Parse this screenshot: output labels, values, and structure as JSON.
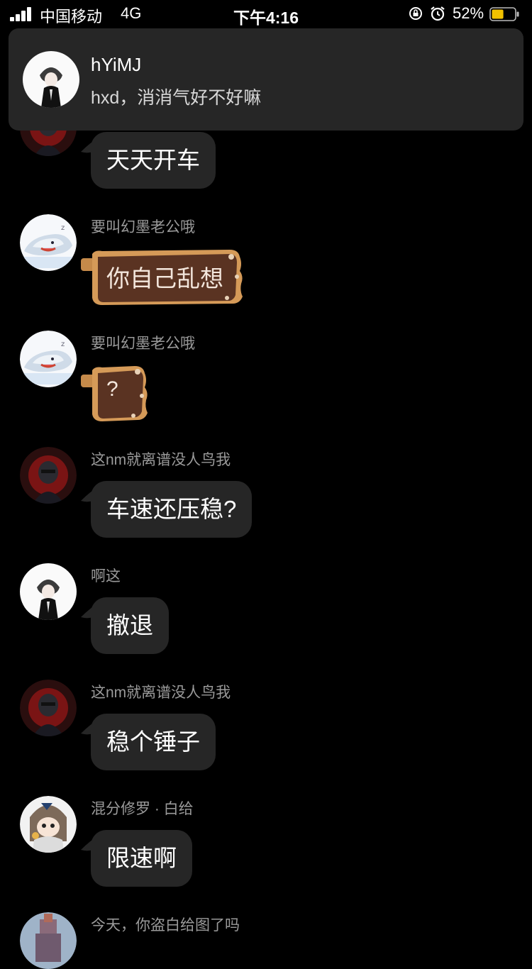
{
  "status_bar": {
    "carrier": "中国移动",
    "network": "4G",
    "time": "下午4:16",
    "battery_percent": "52%",
    "battery_level": 0.52,
    "battery_color": "#f2c200",
    "icons": [
      "signal-icon",
      "rotation-lock-icon",
      "alarm-icon",
      "battery-icon"
    ]
  },
  "notification": {
    "title": "hYiMJ",
    "text": "hxd，消消气好不好嘛"
  },
  "messages": [
    {
      "sender": "",
      "text": "天天开车",
      "style": "bubble",
      "avatar": "dark-red-avatar"
    },
    {
      "sender": "要叫幻墨老公哦",
      "text": "你自己乱想",
      "style": "chocolate",
      "avatar": "shark-avatar"
    },
    {
      "sender": "要叫幻墨老公哦",
      "text": "?",
      "style": "chocolate",
      "avatar": "shark-avatar"
    },
    {
      "sender": "这nm就离谱没人鸟我",
      "text": "车速还压稳?",
      "style": "bubble",
      "avatar": "dark-red-avatar"
    },
    {
      "sender": "啊这",
      "text": "撤退",
      "style": "bubble",
      "avatar": "white-boy-avatar"
    },
    {
      "sender": "这nm就离谱没人鸟我",
      "text": "稳个锤子",
      "style": "bubble",
      "avatar": "dark-red-avatar"
    },
    {
      "sender": "混分修罗 · 白给",
      "text": "限速啊",
      "style": "bubble",
      "avatar": "anime-girl-avatar"
    },
    {
      "sender": "今天，你盗白给图了吗",
      "text": "",
      "style": "bubble",
      "avatar": "castle-avatar"
    }
  ],
  "colors": {
    "background": "#000000",
    "bubble": "#262626",
    "sender": "#9a9a9a",
    "chocolate": "#5a3322"
  }
}
